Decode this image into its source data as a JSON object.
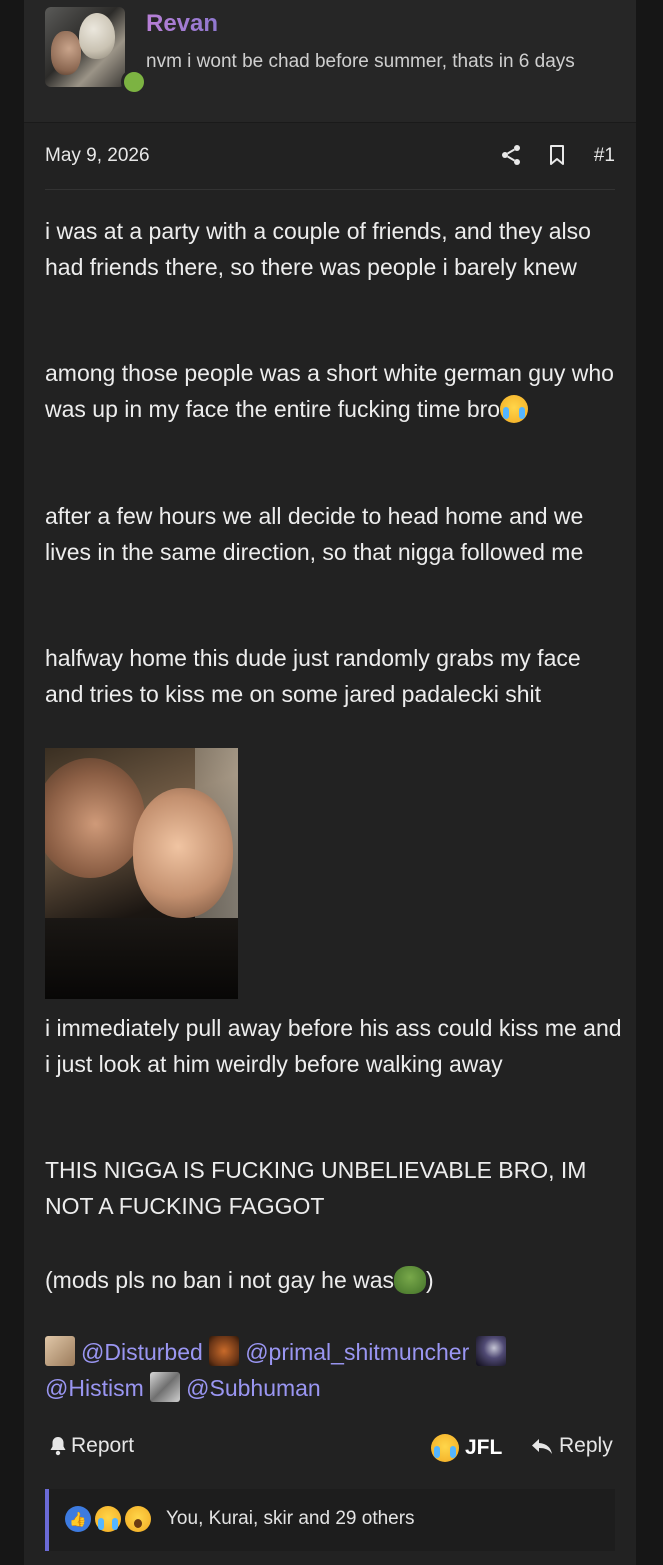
{
  "author": {
    "username": "Revan",
    "title": "nvm i wont be chad before summer, thats in 6 days",
    "online": true
  },
  "post": {
    "date": "May 9, 2026",
    "number": "#1",
    "paragraphs": [
      "i was at a party with a couple of friends, and they also had friends there, so there was people i barely knew",
      "among those people was a short white german guy who was up in my face the entire fucking time bro",
      "after a few hours we all decide to head home and we lives in the same direction, so that nigga followed me",
      "halfway home this dude just randomly grabs my face and tries to kiss me on some jared padalecki shit",
      "i immediately pull away before his ass could kiss me and i just look at him weirdly before walking away",
      "THIS NIGGA IS FUCKING UNBELIEVABLE BRO, IM NOT A FUCKING FAGGOT",
      "(mods pls no ban i not gay he was",
      ")"
    ],
    "mentions": [
      "@Disturbed",
      "@primal_shitmuncher",
      "@Histism",
      "@Subhuman"
    ]
  },
  "actions": {
    "report": "Report",
    "jfl": "JFL",
    "reply": "Reply"
  },
  "reactions": {
    "summary": "You, Kurai, skir and 29 others",
    "icons": [
      "like-icon",
      "crying-laughing-icon",
      "wow-icon"
    ]
  },
  "colors": {
    "username_gradient": [
      "#b87fd6",
      "#8f78cf"
    ],
    "mention": "#9a96f2",
    "online": "#7cb342",
    "reaction_border": "#6b6ad6"
  }
}
